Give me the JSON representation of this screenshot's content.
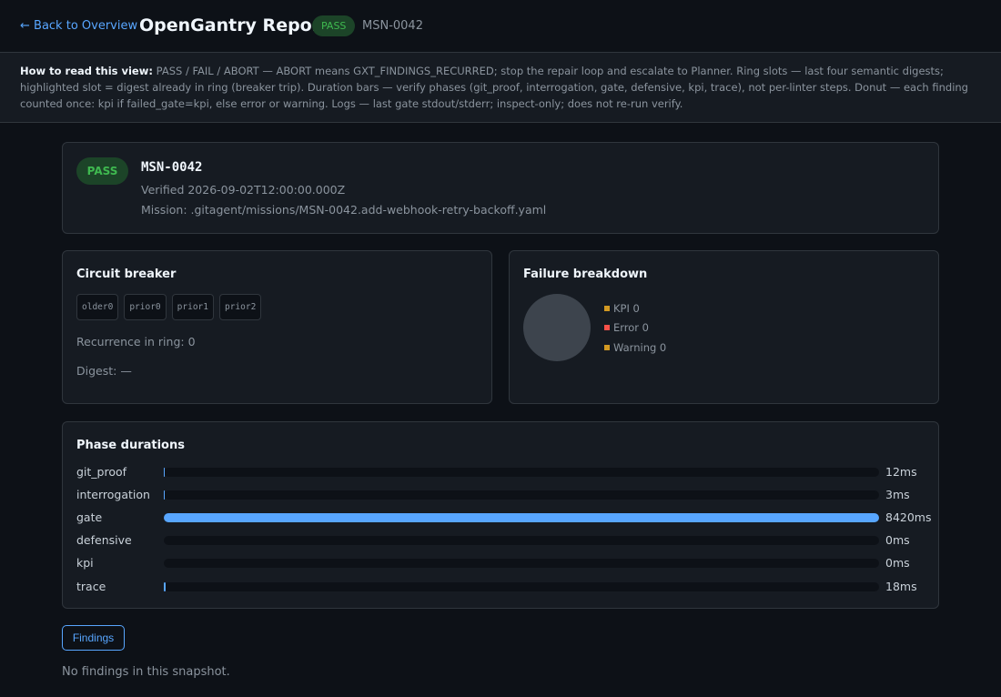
{
  "topbar": {
    "back_label": "← Back to Overview",
    "title": "OpenGantry Report",
    "status": "PASS",
    "mission_id": "MSN-0042"
  },
  "help": {
    "lead": "How to read this view:",
    "text": " PASS / FAIL / ABORT — ABORT means GXT_FINDINGS_RECURRED; stop the repair loop and escalate to Planner. Ring slots — last four semantic digests; highlighted slot = digest already in ring (breaker trip). Duration bars — verify phases (git_proof, interrogation, gate, defensive, kpi, trace), not per-linter steps. Donut — each finding counted once: kpi if failed_gate=kpi, else error or warning. Logs — last gate stdout/stderr; inspect-only; does not re-run verify."
  },
  "summary": {
    "badge": "PASS",
    "mission_id": "MSN-0042",
    "verified": "Verified 2026-09-02T12:00:00.000Z",
    "mission_path": "Mission: .gitagent/missions/MSN-0042.add-webhook-retry-backoff.yaml"
  },
  "breaker": {
    "title": "Circuit breaker",
    "slots": [
      "older0",
      "prior0",
      "prior1",
      "prior2"
    ],
    "recurrence": "Recurrence in ring: 0",
    "digest": "Digest: —"
  },
  "breakdown": {
    "title": "Failure breakdown",
    "legend": [
      {
        "label": "KPI 0",
        "color": "#d29922",
        "value": 0
      },
      {
        "label": "Error 0",
        "color": "#f85149",
        "value": 0
      },
      {
        "label": "Warning 0",
        "color": "#d29922",
        "value": 0
      }
    ]
  },
  "phases": {
    "title": "Phase durations",
    "accent": "#58a6ff",
    "items": [
      {
        "name": "git_proof",
        "ms": 12,
        "label": "12ms"
      },
      {
        "name": "interrogation",
        "ms": 3,
        "label": "3ms"
      },
      {
        "name": "gate",
        "ms": 8420,
        "label": "8420ms"
      },
      {
        "name": "defensive",
        "ms": 0,
        "label": "0ms"
      },
      {
        "name": "kpi",
        "ms": 0,
        "label": "0ms"
      },
      {
        "name": "trace",
        "ms": 18,
        "label": "18ms"
      }
    ]
  },
  "findings": {
    "tab_label": "Findings",
    "empty_text": "No findings in this snapshot."
  }
}
